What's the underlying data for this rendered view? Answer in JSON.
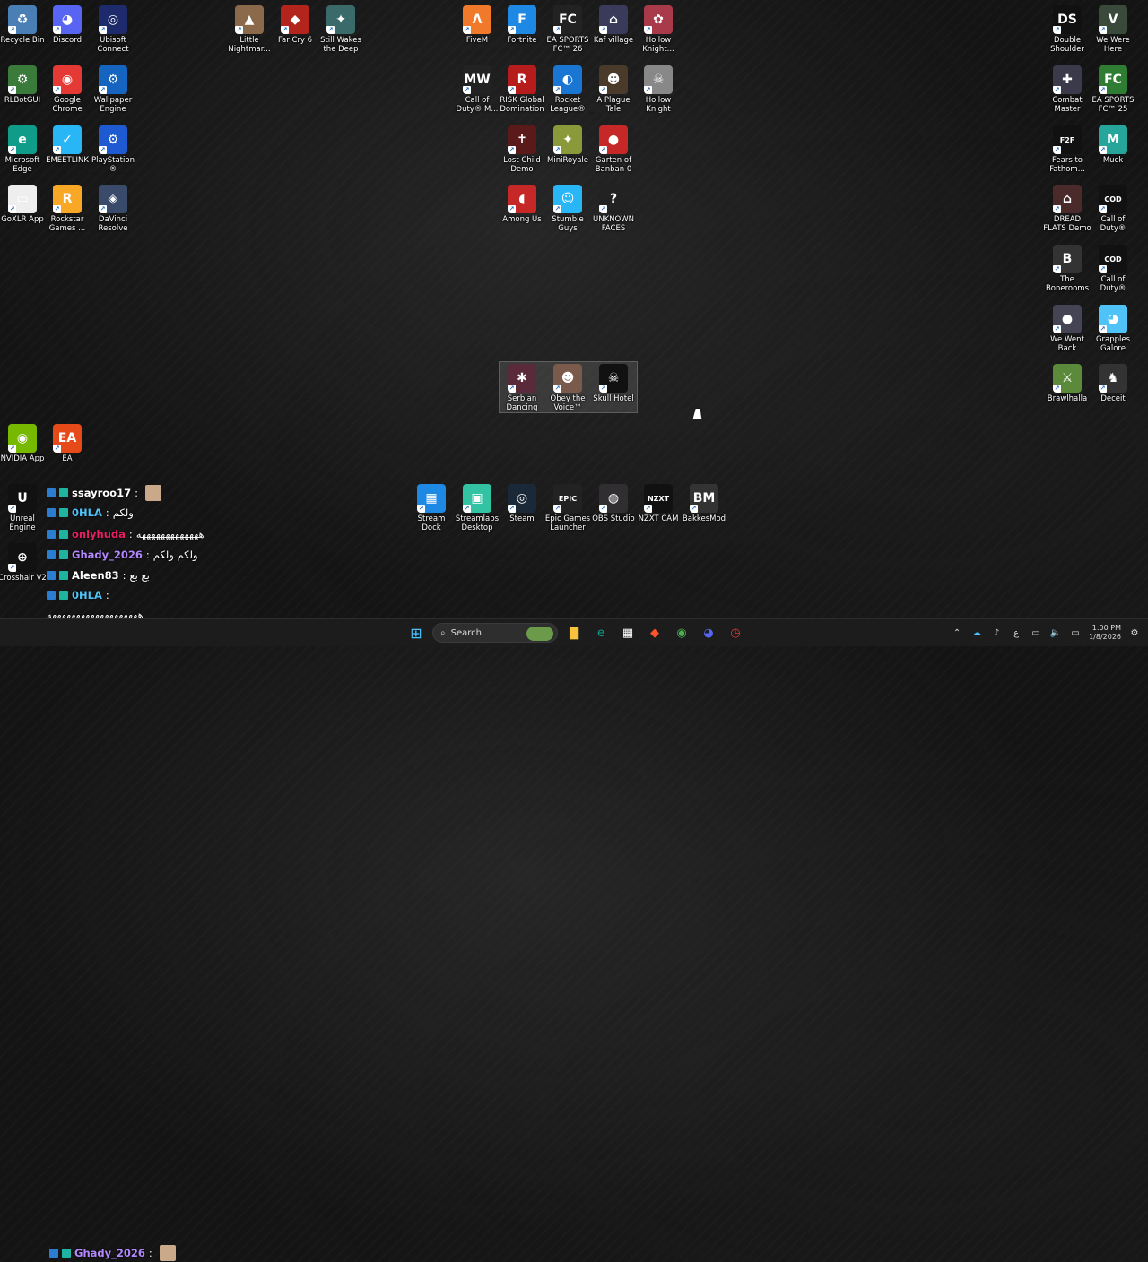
{
  "desktop_icons": [
    {
      "label": "Recycle Bin",
      "icon": "recycle-bin-icon",
      "color": "#4a7fb5",
      "glyph": "♻"
    },
    {
      "label": "Discord",
      "icon": "discord-icon",
      "color": "#5865f2",
      "glyph": "◕"
    },
    {
      "label": "Ubisoft Connect",
      "icon": "ubisoft-icon",
      "color": "#1d2a6b",
      "glyph": "◎"
    },
    {
      "label": "Little Nightmar...",
      "icon": "little-nightmares-icon",
      "color": "#8a6a4a",
      "glyph": "▲"
    },
    {
      "label": "Far Cry 6",
      "icon": "far-cry-icon",
      "color": "#b3241c",
      "glyph": "◆"
    },
    {
      "label": "Still Wakes the Deep",
      "icon": "still-wakes-icon",
      "color": "#3a6a6a",
      "glyph": "✦"
    },
    {
      "label": "FiveM",
      "icon": "fivem-icon",
      "color": "#f07a2a",
      "glyph": "Λ"
    },
    {
      "label": "Fortnite",
      "icon": "fortnite-icon",
      "color": "#1e88e5",
      "glyph": "F"
    },
    {
      "label": "EA SPORTS FC™ 26",
      "icon": "ea-fc26-icon",
      "color": "#222",
      "glyph": "FC"
    },
    {
      "label": "Kaf village",
      "icon": "kaf-village-icon",
      "color": "#3a3a5a",
      "glyph": "⌂"
    },
    {
      "label": "Hollow Knight...",
      "icon": "hollow-knight-silksong-icon",
      "color": "#a83a4a",
      "glyph": "✿"
    },
    {
      "label": "Double Shoulder",
      "icon": "double-shoulder-icon",
      "color": "#111",
      "glyph": "DS"
    },
    {
      "label": "We Were Here",
      "icon": "we-were-here-icon",
      "color": "#3a4a3a",
      "glyph": "V"
    },
    {
      "label": "RLBotGUI",
      "icon": "rlbot-icon",
      "color": "#3a7a3a",
      "glyph": "⚙"
    },
    {
      "label": "Google Chrome",
      "icon": "chrome-icon",
      "color": "#e53935",
      "glyph": "◉"
    },
    {
      "label": "Wallpaper Engine",
      "icon": "wallpaper-engine-icon",
      "color": "#1565c0",
      "glyph": "⚙"
    },
    {
      "label": "Call of Duty® M...",
      "icon": "cod-mw3-icon",
      "color": "#222",
      "glyph": "MW"
    },
    {
      "label": "RISK Global Domination",
      "icon": "risk-icon",
      "color": "#b71c1c",
      "glyph": "R"
    },
    {
      "label": "Rocket League®",
      "icon": "rocket-league-icon",
      "color": "#1976d2",
      "glyph": "◐"
    },
    {
      "label": "A Plague Tale Requiem - ...",
      "icon": "plague-tale-icon",
      "color": "#4a3a2a",
      "glyph": "☻"
    },
    {
      "label": "Hollow Knight",
      "icon": "hollow-knight-icon",
      "color": "#888",
      "glyph": "☠"
    },
    {
      "label": "Combat Master",
      "icon": "combat-master-icon",
      "color": "#3a3a4a",
      "glyph": "✚"
    },
    {
      "label": "EA SPORTS FC™ 25",
      "icon": "ea-fc25-icon",
      "color": "#2e7d32",
      "glyph": "FC"
    },
    {
      "label": "Microsoft Edge",
      "icon": "edge-icon",
      "color": "#0f9d8a",
      "glyph": "e"
    },
    {
      "label": "EMEETLINK",
      "icon": "emeetlink-icon",
      "color": "#29b6f6",
      "glyph": "✓"
    },
    {
      "label": "PlayStation® Accessories",
      "icon": "playstation-icon",
      "color": "#1e5ad1",
      "glyph": "⚙"
    },
    {
      "label": "Lost Child Demo",
      "icon": "lost-child-icon",
      "color": "#5a1a1a",
      "glyph": "✝"
    },
    {
      "label": "MiniRoyale",
      "icon": "miniroyale-icon",
      "color": "#8a9a3a",
      "glyph": "✦"
    },
    {
      "label": "Garten of Banban 0",
      "icon": "garten-banban-icon",
      "color": "#c62828",
      "glyph": "●"
    },
    {
      "label": "Fears to Fathom...",
      "icon": "fears-to-fathom-icon",
      "color": "#111",
      "glyph": "F2F"
    },
    {
      "label": "Muck",
      "icon": "muck-icon",
      "color": "#26a69a",
      "glyph": "M"
    },
    {
      "label": "GoXLR App",
      "icon": "goxlr-icon",
      "color": "#eee",
      "glyph": "▭"
    },
    {
      "label": "Rockstar Games ...",
      "icon": "rockstar-icon",
      "color": "#f9a825",
      "glyph": "R"
    },
    {
      "label": "DaVinci Resolve",
      "icon": "davinci-icon",
      "color": "#3a4a6a",
      "glyph": "◈"
    },
    {
      "label": "Among Us",
      "icon": "among-us-icon",
      "color": "#c62828",
      "glyph": "◖"
    },
    {
      "label": "Stumble Guys",
      "icon": "stumble-guys-icon",
      "color": "#29b6f6",
      "glyph": "☺"
    },
    {
      "label": "UNKNOWN FACES",
      "icon": "unknown-faces-icon",
      "color": "#222",
      "glyph": "?"
    },
    {
      "label": "DREAD FLATS Demo",
      "icon": "dread-flats-icon",
      "color": "#4a2a2a",
      "glyph": "⌂"
    },
    {
      "label": "Call of Duty®",
      "icon": "cod-icon-1",
      "color": "#111",
      "glyph": "COD"
    },
    {
      "label": "The Bonerooms",
      "icon": "bonerooms-icon",
      "color": "#333",
      "glyph": "B"
    },
    {
      "label": "Call of Duty®",
      "icon": "cod-icon-2",
      "color": "#111",
      "glyph": "COD"
    },
    {
      "label": "We Went Back",
      "icon": "we-went-back-icon",
      "color": "#445",
      "glyph": "●"
    },
    {
      "label": "Grapples Galore",
      "icon": "grapples-galore-icon",
      "color": "#4fc3f7",
      "glyph": "◕"
    },
    {
      "label": "Serbian Dancing Lady",
      "icon": "serbian-dancing-lady-icon",
      "color": "#5a2a3a",
      "glyph": "✱"
    },
    {
      "label": "Obey the Voice™ Demo",
      "icon": "obey-the-voice-icon",
      "color": "#7a5a4a",
      "glyph": "☻"
    },
    {
      "label": "Skull Hotel",
      "icon": "skull-hotel-icon",
      "color": "#111",
      "glyph": "☠"
    },
    {
      "label": "Brawlhalla",
      "icon": "brawlhalla-icon",
      "color": "#5a8a3a",
      "glyph": "⚔"
    },
    {
      "label": "Deceit",
      "icon": "deceit-icon",
      "color": "#333",
      "glyph": "♞"
    },
    {
      "label": "NVIDIA App",
      "icon": "nvidia-icon",
      "color": "#76b900",
      "glyph": "◉"
    },
    {
      "label": "EA",
      "icon": "ea-icon",
      "color": "#e64a19",
      "glyph": "EA"
    },
    {
      "label": "Stream Dock",
      "icon": "stream-dock-icon",
      "color": "#1e88e5",
      "glyph": "▦"
    },
    {
      "label": "Streamlabs Desktop",
      "icon": "streamlabs-icon",
      "color": "#31c3a2",
      "glyph": "▣"
    },
    {
      "label": "Steam",
      "icon": "steam-icon",
      "color": "#1b2838",
      "glyph": "◎"
    },
    {
      "label": "Epic Games Launcher",
      "icon": "epic-games-icon",
      "color": "#222",
      "glyph": "EPIC"
    },
    {
      "label": "OBS Studio",
      "icon": "obs-icon",
      "color": "#302e31",
      "glyph": "◍"
    },
    {
      "label": "NZXT CAM",
      "icon": "nzxt-cam-icon",
      "color": "#111",
      "glyph": "NZXT"
    },
    {
      "label": "BakkesMod",
      "icon": "bakkesmod-icon",
      "color": "#333",
      "glyph": "BM"
    },
    {
      "label": "Unreal Engine",
      "icon": "unreal-engine-icon",
      "color": "#111",
      "glyph": "U"
    },
    {
      "label": "Crosshair V2",
      "icon": "crosshair-icon",
      "color": "#111",
      "glyph": "⊕"
    }
  ],
  "chat": [
    {
      "user": "ssayroo17",
      "sep": " :",
      "msg": "",
      "color": "#ffffff"
    },
    {
      "user": "0HLA",
      "sep": " :",
      "msg": "ولكم",
      "color": "#4fc3f7"
    },
    {
      "user": "onlyhuda",
      "sep": " :",
      "msg": "هههههههههههههه",
      "color": "#e91e63"
    },
    {
      "user": "Ghady_2026",
      "sep": " :",
      "msg": "ولكم ولكم",
      "color": "#b388ff"
    },
    {
      "user": "Aleen83",
      "sep": " :",
      "msg": "بع بع",
      "color": "#ffffff"
    },
    {
      "user": "0HLA",
      "sep": " :",
      "msg": "",
      "color": "#4fc3f7"
    },
    {
      "user": "",
      "sep": "",
      "msg": "هههههههههههههههههههه",
      "color": "#ffffff"
    },
    {
      "user": "Ghady_2026",
      "sep": " :",
      "msg": "",
      "color": "#b388ff"
    }
  ],
  "taskbar": {
    "search_placeholder": "Search",
    "time": "1:00 PM",
    "date": "1/8/2026",
    "lang": "ع",
    "apps": [
      {
        "name": "file-explorer-icon",
        "glyph": "▇",
        "color": "#f9c23c"
      },
      {
        "name": "edge-icon",
        "glyph": "e",
        "color": "#0f9d8a"
      },
      {
        "name": "store-icon",
        "glyph": "▦",
        "color": "#fff"
      },
      {
        "name": "brave-icon",
        "glyph": "◆",
        "color": "#fb542b"
      },
      {
        "name": "chrome-icon",
        "glyph": "◉",
        "color": "#4caf50"
      },
      {
        "name": "discord-icon",
        "glyph": "◕",
        "color": "#5865f2"
      },
      {
        "name": "clock-app-icon",
        "glyph": "◷",
        "color": "#e53935"
      }
    ]
  }
}
